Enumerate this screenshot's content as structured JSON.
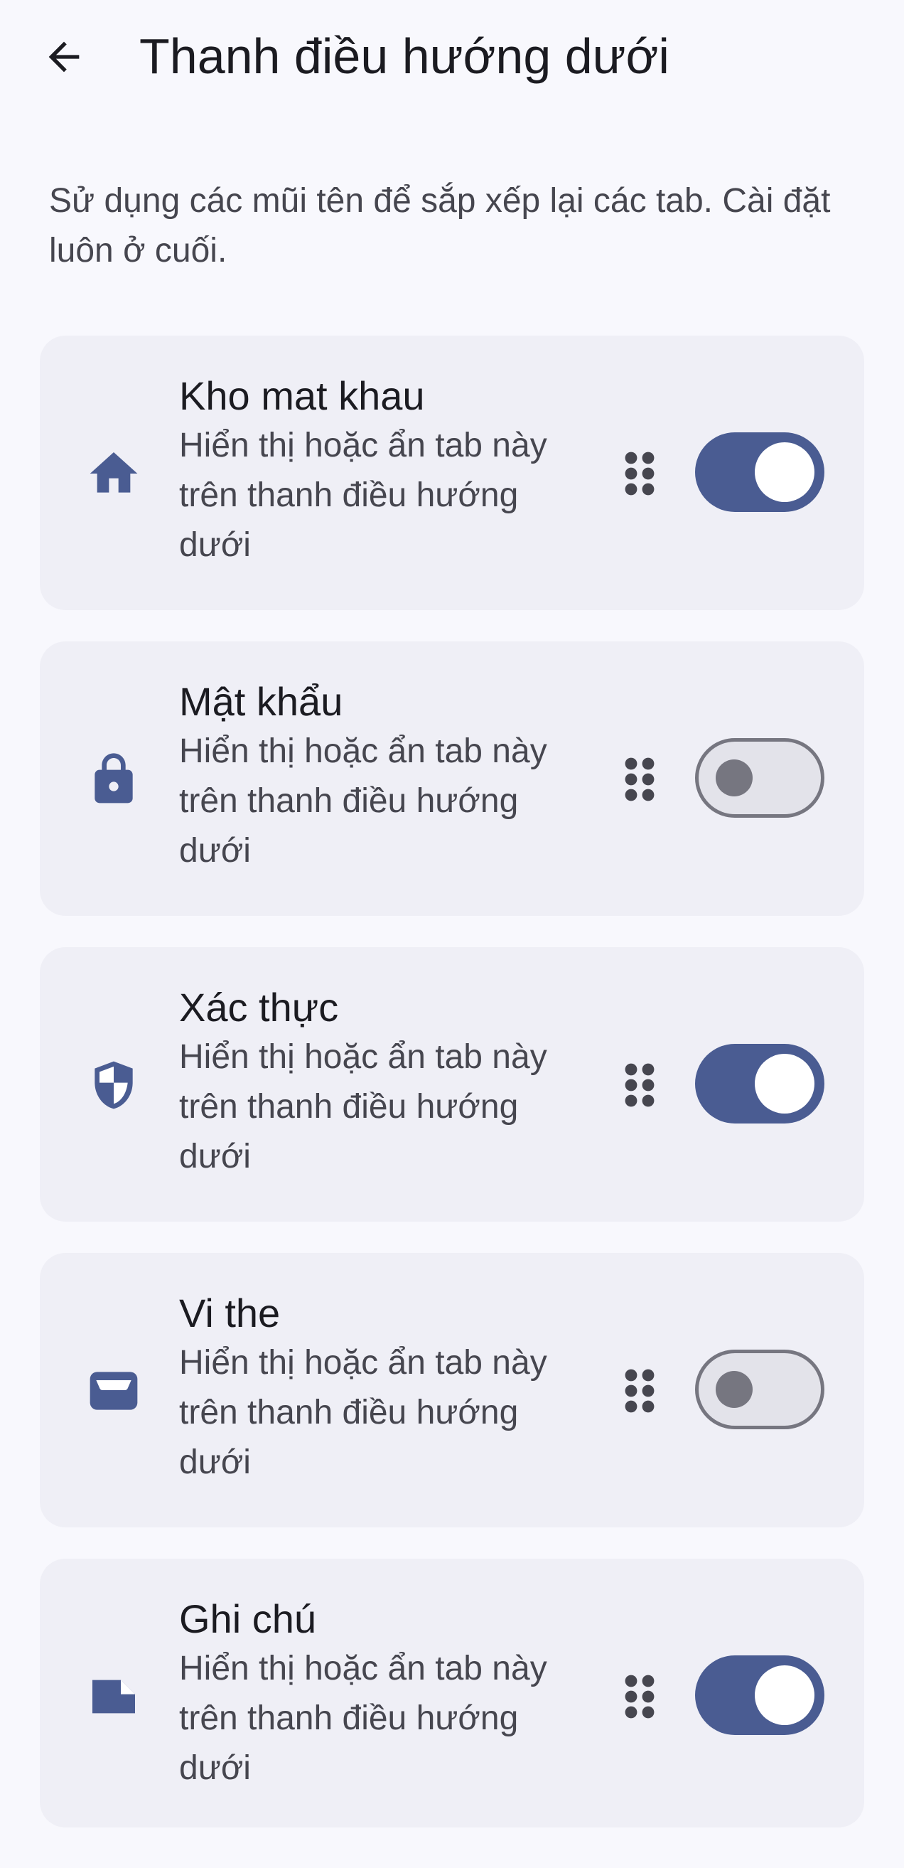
{
  "header": {
    "back_label": "Back",
    "title": "Thanh điều hướng dưới"
  },
  "description": "Sử dụng các mũi tên để sắp xếp lại các tab. Cài đặt luôn ở cuối.",
  "colors": {
    "accent": "#4a5c92",
    "card_background": "#efeff6",
    "page_background": "#f8f8fd"
  },
  "tabs": [
    {
      "icon": "home-icon",
      "title": "Kho mat khau",
      "subtitle": "Hiển thị hoặc ẩn tab này trên thanh điều hướng dưới",
      "enabled": true
    },
    {
      "icon": "lock-icon",
      "title": "Mật khẩu",
      "subtitle": "Hiển thị hoặc ẩn tab này trên thanh điều hướng dưới",
      "enabled": false
    },
    {
      "icon": "shield-icon",
      "title": "Xác thực",
      "subtitle": "Hiển thị hoặc ẩn tab này trên thanh điều hướng dưới",
      "enabled": true
    },
    {
      "icon": "wallet-icon",
      "title": "Vi the",
      "subtitle": "Hiển thị hoặc ẩn tab này trên thanh điều hướng dưới",
      "enabled": false
    },
    {
      "icon": "note-icon",
      "title": "Ghi chú",
      "subtitle": "Hiển thị hoặc ẩn tab này trên thanh điều hướng dưới",
      "enabled": true
    }
  ]
}
